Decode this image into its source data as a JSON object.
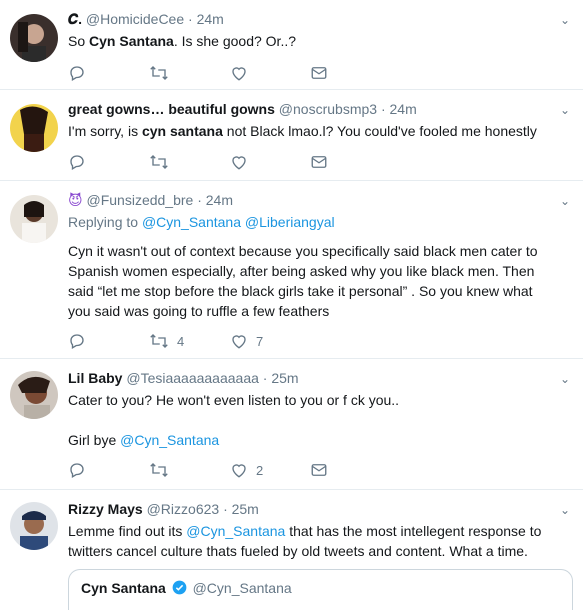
{
  "tweets": [
    {
      "name": "𝑪.",
      "handle": "@HomicideCee",
      "time": "· 24m",
      "text_pre": "So ",
      "text_bold": "Cyn Santana",
      "text_post": ". Is she good? Or..?",
      "actions": {
        "reply": "",
        "retweet": "",
        "like": ""
      }
    },
    {
      "name": "great gowns… beautiful gowns",
      "handle": "@noscrubsmp3",
      "time": "· 24m",
      "text_pre": "I'm sorry, is ",
      "text_bold": "cyn santana",
      "text_post": " not Black lmao.l? You could've fooled me honestly",
      "actions": {
        "reply": "",
        "retweet": "",
        "like": ""
      }
    },
    {
      "name_emoji": "😈",
      "handle": "@Funsizedd_bre",
      "time": "· 24m",
      "replying_label": "Replying to",
      "replying_to_1": "@Cyn_Santana",
      "replying_to_2": "@Liberiangyal",
      "text": "Cyn it wasn't out of context because you specifically said black men cater to Spanish women especially, after being asked why you like black men. Then said “let me stop before the black girls take it personal” . So you knew what you said was going to ruffle a few feathers",
      "actions": {
        "reply": "",
        "retweet": "4",
        "like": "7"
      }
    },
    {
      "name": "Lil Baby",
      "handle": "@Tesiaaaaaaaaaaaa",
      "time": "· 25m",
      "text_line1": "Cater to you? He won't even listen to you or f  ck you..",
      "text_line2_pre": "Girl bye ",
      "text_line2_mention": "@Cyn_Santana",
      "actions": {
        "reply": "",
        "retweet": "",
        "like": "2"
      }
    },
    {
      "name": "Rizzy Mays",
      "handle": "@Rizzo623",
      "time": "· 25m",
      "text_pre": "Lemme find out its ",
      "text_mention": "@Cyn_Santana",
      "text_post": " that has the most intellegent response to twitters cancel culture thats fueled by old tweets and content. What a time.",
      "quote": {
        "name": "Cyn Santana",
        "handle": "@Cyn_Santana"
      }
    }
  ],
  "colors": {
    "accent": "#1b95e0",
    "muted": "#657786",
    "divider": "#e6ecf0"
  }
}
